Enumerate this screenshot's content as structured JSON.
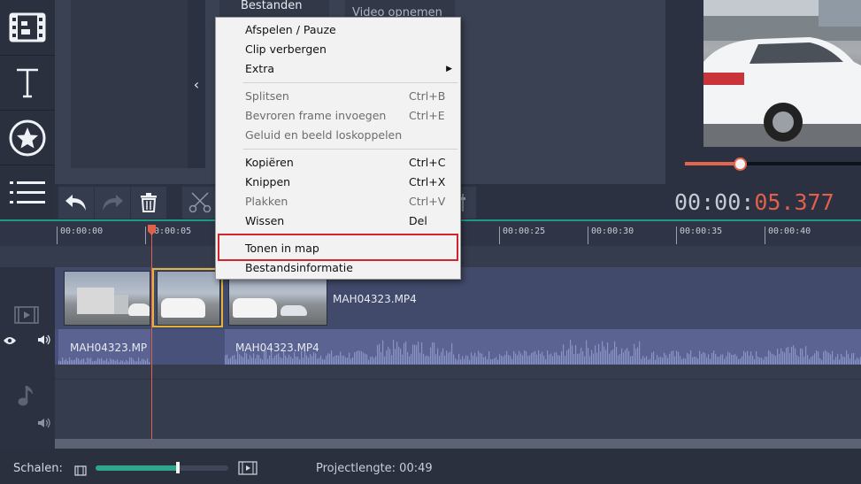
{
  "sidebar": {
    "items": [
      {
        "name": "media-files-icon"
      },
      {
        "name": "titles-icon"
      },
      {
        "name": "stickers-icon"
      },
      {
        "name": "more-tools-icon"
      }
    ]
  },
  "files_panel": {
    "tab_files": "Bestanden",
    "tab_record": "Video opnemen",
    "collapse_glyph": "‹"
  },
  "toolbar": {
    "timecode_grey": "00:00:",
    "timecode_red": "05.377"
  },
  "ruler": {
    "ticks": [
      "00:00:00",
      "00:00:05",
      "00:00:25",
      "00:00:30",
      "00:00:35",
      "00:00:40"
    ]
  },
  "timeline": {
    "clip_video_label": "MAH04323.MP4",
    "clip_audio_left_label": "MAH04323.MP",
    "clip_audio_right_label": "MAH04323.MP4"
  },
  "statusbar": {
    "scale_label": "Schalen:",
    "zoom_level": 0.62,
    "project_length": "Projectlengte:  00:49"
  },
  "context_menu": {
    "items": [
      {
        "label": "Afspelen / Pauze",
        "shortcut": "",
        "enabled": true
      },
      {
        "label": "Clip verbergen",
        "shortcut": "",
        "enabled": true
      },
      {
        "label": "Extra",
        "shortcut": "",
        "enabled": true,
        "submenu": true
      },
      {
        "label": "Splitsen",
        "shortcut": "Ctrl+B",
        "enabled": false
      },
      {
        "label": "Bevroren frame invoegen",
        "shortcut": "Ctrl+E",
        "enabled": false
      },
      {
        "label": "Geluid en beeld loskoppelen",
        "shortcut": "",
        "enabled": false
      },
      {
        "label": "Kopiëren",
        "shortcut": "Ctrl+C",
        "enabled": true
      },
      {
        "label": "Knippen",
        "shortcut": "Ctrl+X",
        "enabled": true
      },
      {
        "label": "Plakken",
        "shortcut": "Ctrl+V",
        "enabled": false
      },
      {
        "label": "Wissen",
        "shortcut": "Del",
        "enabled": true
      },
      {
        "label": "Tonen in map",
        "shortcut": "",
        "enabled": true,
        "highlighted": true
      },
      {
        "label": "Bestandsinformatie",
        "shortcut": "",
        "enabled": true
      }
    ],
    "submenu_arrow": "▶"
  },
  "colors": {
    "accent_teal": "#1d9a86",
    "playhead_red": "#e2604b",
    "selection_yellow": "#e8b23a",
    "highlight_red": "#d1242d"
  }
}
